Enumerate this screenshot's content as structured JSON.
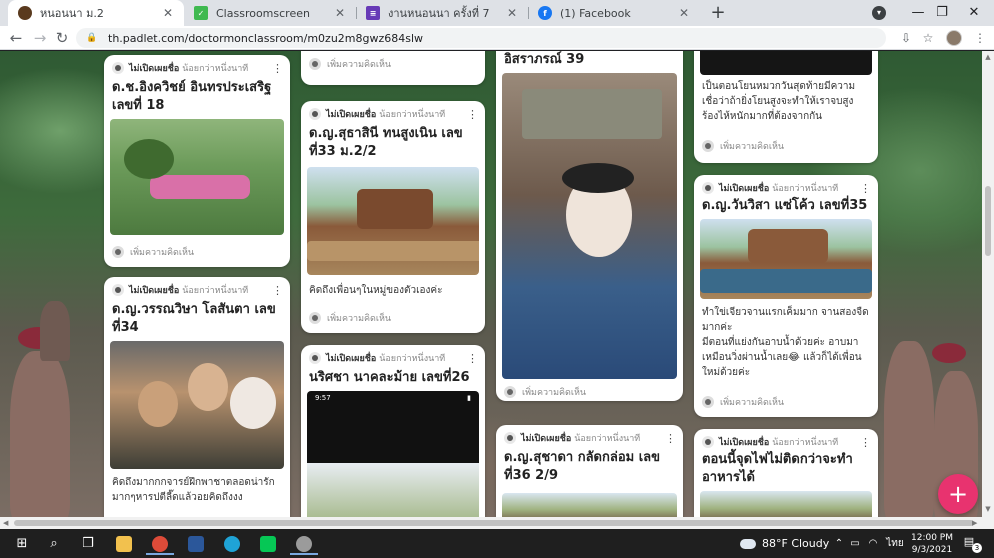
{
  "browser": {
    "tabs": [
      {
        "title": "หนอนนา ม.2",
        "active": true
      },
      {
        "title": "Classroomscreen",
        "active": false
      },
      {
        "title": "งานหนอนนา ครั้งที่ 7",
        "active": false
      },
      {
        "title": "(1) Facebook",
        "active": false
      }
    ],
    "url": "th.padlet.com/doctormonclassroom/m0zu2m8gwz684slw",
    "colors": {
      "tab_bar": "#dee1e6",
      "accent_pink": "#e8336f"
    }
  },
  "padlet": {
    "author": "ไม่เปิดเผยชื่อ",
    "time": "น้อยกว่าหนึ่งนาที",
    "add_comment": "เพิ่มความคิดเห็น",
    "cards": [
      {
        "id": "c1",
        "title": "ด.ช.อิงควิชย์ อินทรประเสริฐ เลขที่ 18",
        "body": ""
      },
      {
        "id": "c2",
        "title": "ด.ญ.วรรณวิษา โลสันตา เลขที่34",
        "body": "คิดถึงมากกกจารย์ฝึกพาชาตลอดน่ารักมากๆหารปตีลี๊ดแล้วอยคิดถึงงง"
      },
      {
        "id": "c3",
        "title": "ด.ญ.สุธาสินี ทนสูงเนิน เลขที่33 ม.2/2",
        "body": "คิดถึงเพื่อนๆในหมู่ของตัวเองค่ะ"
      },
      {
        "id": "c4",
        "title": "นริศชา นาคละม้าย เลขที่26",
        "body": ""
      },
      {
        "id": "c5",
        "title": "อิสราภรณ์ 39",
        "body": ""
      },
      {
        "id": "c6",
        "title": "ด.ญ.สุชาดา กลัดกล่อม เลขที่36 2/9",
        "body": ""
      },
      {
        "id": "c7",
        "title": "",
        "body": "เป็นตอนโยนหมวกวันสุดท้ายมีความเชื่อว่าถ้ายิ่งโยนสูงจะทำให้เราจบสูงร้องไห้หนักมากที่ต้องจากกัน"
      },
      {
        "id": "c8",
        "title": "ด.ญ.วันวิสา แซ่โค้ว เลขที่35",
        "body": "ทำใข่เจียวจานแรกเค็มมาก จานสองจืดมากค่ะ\nมีตอนที่แย่งกันอาบน้ำด้วยค่ะ อาบมาเหมือนวิ่งผ่านน้ำเลย😂 แล้วก็ได้เพื่อนใหม่ด้วยค่ะ"
      },
      {
        "id": "c9",
        "title": "ตอนนี้จุดไฟไม่ติดกว่าจะทำอาหารได้",
        "body": ""
      }
    ],
    "phone_status": "9:57"
  },
  "taskbar": {
    "weather": "88°F  Cloudy",
    "lang": "ไทย",
    "time": "12:00 PM",
    "date": "9/3/2021",
    "notification_count": "3"
  }
}
